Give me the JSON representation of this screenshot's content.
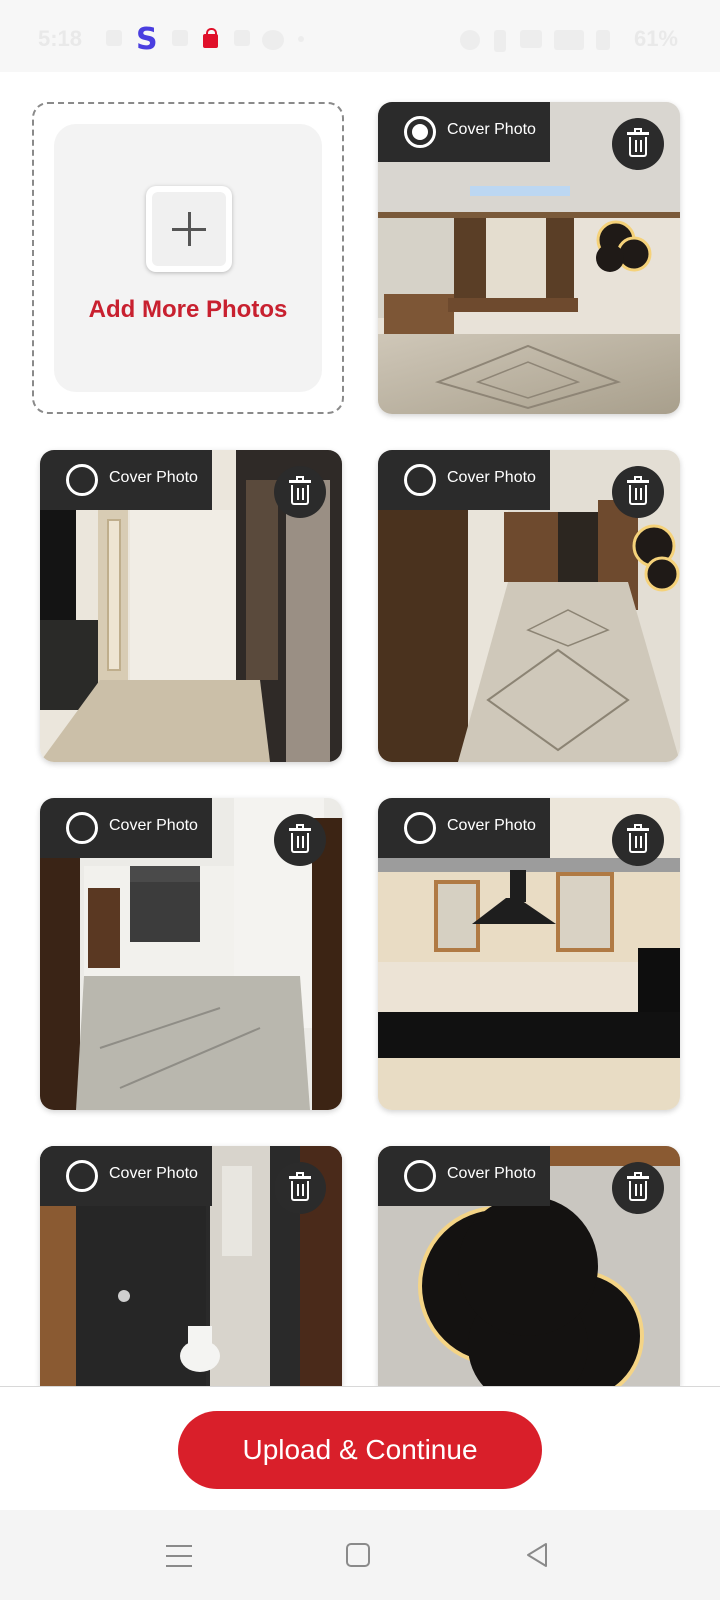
{
  "status_bar": {
    "time": "5:18",
    "battery": "61%",
    "icons": [
      "shield-icon",
      "s-logo-icon",
      "send-icon",
      "bag-icon",
      "location-icon",
      "chat-icon",
      "dot-icon",
      "alarm-icon",
      "vibrate-icon",
      "wifi-icon",
      "signal-icon",
      "battery-icon"
    ],
    "s_logo_text": "S",
    "s_logo_color": "#4a3ee0",
    "bag_color": "#e0102a"
  },
  "add_tile": {
    "label": "Add More Photos",
    "icon": "plus-icon",
    "label_color": "#c8202f"
  },
  "photos": [
    {
      "cover_label": "Cover Photo",
      "selected": true,
      "delete_icon": "trash-icon",
      "scene": "living room with wooden console and backlit wall panel"
    },
    {
      "cover_label": "Cover Photo",
      "selected": false,
      "delete_icon": "trash-icon",
      "scene": "balcony with jali partition"
    },
    {
      "cover_label": "Cover Photo",
      "selected": false,
      "delete_icon": "trash-icon",
      "scene": "hallway with marble floor"
    },
    {
      "cover_label": "Cover Photo",
      "selected": false,
      "delete_icon": "trash-icon",
      "scene": "empty bedroom"
    },
    {
      "cover_label": "Cover Photo",
      "selected": false,
      "delete_icon": "trash-icon",
      "scene": "modular kitchen"
    },
    {
      "cover_label": "Cover Photo",
      "selected": false,
      "delete_icon": "trash-icon",
      "scene": "bathroom with black tiles"
    },
    {
      "cover_label": "Cover Photo",
      "selected": false,
      "delete_icon": "trash-icon",
      "scene": "backlit cloud shaped panel"
    }
  ],
  "actions": {
    "upload_label": "Upload & Continue",
    "button_color": "#d91f2a"
  },
  "nav_bar": {
    "icons": [
      "menu-icon",
      "home-icon",
      "back-icon"
    ]
  }
}
